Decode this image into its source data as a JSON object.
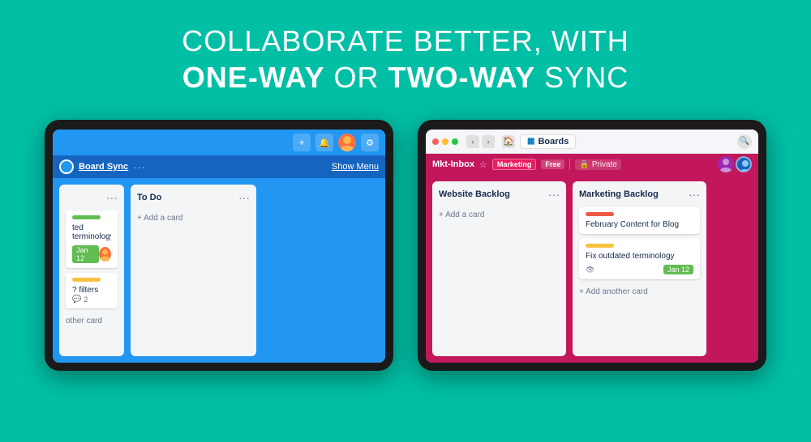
{
  "hero": {
    "line1": "COLLABORATE BETTER, WITH",
    "line2_part1": "ONE-WAY",
    "line2_mid": " OR ",
    "line2_part2": "TWO-WAY",
    "line2_end": " SYNC"
  },
  "left_tablet": {
    "toolbar": {
      "plus_label": "+",
      "bell_label": "🔔",
      "gear_label": "⚙"
    },
    "board_bar": {
      "board_name": "Board Sync",
      "dots": "···",
      "show_menu": "Show Menu"
    },
    "columns": {
      "partial": {
        "card1_text": "ted terminology",
        "card1_date": "Jan 12",
        "card2_text": "? filters",
        "card2_comments": "2",
        "footer": "other card"
      },
      "todo": {
        "title": "To Do",
        "add_card": "+ Add a card"
      }
    }
  },
  "right_tablet": {
    "browser_bar": {
      "boards_label": "Boards"
    },
    "board_bar": {
      "board_name": "Mkt-Inbox",
      "tag_marketing": "Marketing",
      "tag_free": "Free",
      "lock_label": "Private"
    },
    "columns": {
      "website": {
        "title": "Website Backlog",
        "dots": "···",
        "add_card": "+ Add a card"
      },
      "marketing": {
        "title": "Marketing Backlog",
        "dots": "···",
        "card1_text": "February Content for Blog",
        "card2_text": "Fix outdated terminology",
        "card2_date": "Jan 12",
        "add_card": "+ Add another card"
      }
    }
  }
}
